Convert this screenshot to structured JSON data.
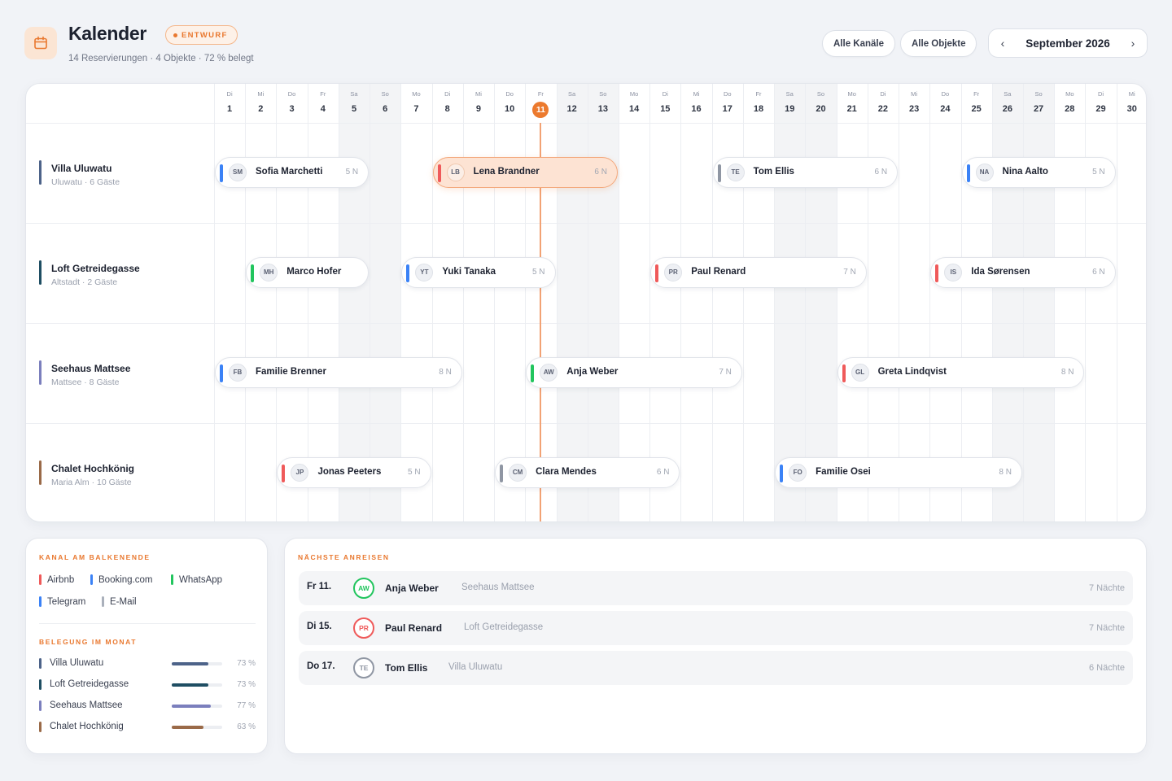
{
  "header": {
    "title": "Kalender",
    "badge": "ENTWURF",
    "subtitle": "14 Reservierungen · 4 Objekte · 72 % belegt",
    "filter_channels": "Alle Kanäle",
    "filter_objects": "Alle Objekte",
    "month": "September 2026",
    "prev_icon": "‹",
    "next_icon": "›"
  },
  "calendar": {
    "today": 11,
    "days": [
      {
        "wd": "Di",
        "d": 1
      },
      {
        "wd": "Mi",
        "d": 2
      },
      {
        "wd": "Do",
        "d": 3
      },
      {
        "wd": "Fr",
        "d": 4
      },
      {
        "wd": "Sa",
        "d": 5
      },
      {
        "wd": "So",
        "d": 6
      },
      {
        "wd": "Mo",
        "d": 7
      },
      {
        "wd": "Di",
        "d": 8
      },
      {
        "wd": "Mi",
        "d": 9
      },
      {
        "wd": "Do",
        "d": 10
      },
      {
        "wd": "Fr",
        "d": 11
      },
      {
        "wd": "Sa",
        "d": 12
      },
      {
        "wd": "So",
        "d": 13
      },
      {
        "wd": "Mo",
        "d": 14
      },
      {
        "wd": "Di",
        "d": 15
      },
      {
        "wd": "Mi",
        "d": 16
      },
      {
        "wd": "Do",
        "d": 17
      },
      {
        "wd": "Fr",
        "d": 18
      },
      {
        "wd": "Sa",
        "d": 19
      },
      {
        "wd": "So",
        "d": 20
      },
      {
        "wd": "Mo",
        "d": 21
      },
      {
        "wd": "Di",
        "d": 22
      },
      {
        "wd": "Mi",
        "d": 23
      },
      {
        "wd": "Do",
        "d": 24
      },
      {
        "wd": "Fr",
        "d": 25
      },
      {
        "wd": "Sa",
        "d": 26
      },
      {
        "wd": "So",
        "d": 27
      },
      {
        "wd": "Mo",
        "d": 28
      },
      {
        "wd": "Di",
        "d": 29
      },
      {
        "wd": "Mi",
        "d": 30
      }
    ],
    "properties": [
      {
        "name": "Villa Uluwatu",
        "sub": "Uluwatu · 6 Gäste",
        "color": "#4d6389",
        "reservations": [
          {
            "initials": "SM",
            "name": "Sofia Marchetti",
            "nights": "5 N",
            "start": 1,
            "end": 5,
            "channel": "#3b82f6"
          },
          {
            "initials": "LB",
            "name": "Lena Brandner",
            "nights": "6 N",
            "start": 8,
            "end": 13,
            "channel": "#ef5a5a",
            "selected": true
          },
          {
            "initials": "TE",
            "name": "Tom Ellis",
            "nights": "6 N",
            "start": 17,
            "end": 22,
            "channel": "#8f96a3"
          },
          {
            "initials": "NA",
            "name": "Nina Aalto",
            "nights": "5 N",
            "start": 25,
            "end": 29,
            "channel": "#3b82f6"
          }
        ]
      },
      {
        "name": "Loft Getreidegasse",
        "sub": "Altstadt · 2 Gäste",
        "color": "#1f4e63",
        "reservations": [
          {
            "initials": "MH",
            "name": "Marco Hofer",
            "nights": "",
            "start": 2,
            "end": 5,
            "channel": "#22c55e"
          },
          {
            "initials": "YT",
            "name": "Yuki Tanaka",
            "nights": "5 N",
            "start": 7,
            "end": 11,
            "channel": "#3b82f6"
          },
          {
            "initials": "PR",
            "name": "Paul Renard",
            "nights": "7 N",
            "start": 15,
            "end": 21,
            "channel": "#ef5a5a"
          },
          {
            "initials": "IS",
            "name": "Ida Sørensen",
            "nights": "6 N",
            "start": 24,
            "end": 29,
            "channel": "#ef5a5a"
          }
        ]
      },
      {
        "name": "Seehaus Mattsee",
        "sub": "Mattsee · 8 Gäste",
        "color": "#7b7fbd",
        "reservations": [
          {
            "initials": "FB",
            "name": "Familie Brenner",
            "nights": "8 N",
            "start": 1,
            "end": 8,
            "channel": "#3b82f6"
          },
          {
            "initials": "AW",
            "name": "Anja Weber",
            "nights": "7 N",
            "start": 11,
            "end": 17,
            "channel": "#22c55e"
          },
          {
            "initials": "GL",
            "name": "Greta Lindqvist",
            "nights": "8 N",
            "start": 21,
            "end": 28,
            "channel": "#ef5a5a"
          }
        ]
      },
      {
        "name": "Chalet Hochkönig",
        "sub": "Maria Alm · 10 Gäste",
        "color": "#9a6a48",
        "reservations": [
          {
            "initials": "JP",
            "name": "Jonas Peeters",
            "nights": "5 N",
            "start": 3,
            "end": 7,
            "channel": "#ef5a5a"
          },
          {
            "initials": "CM",
            "name": "Clara Mendes",
            "nights": "6 N",
            "start": 10,
            "end": 15,
            "channel": "#8f96a3"
          },
          {
            "initials": "FO",
            "name": "Familie Osei",
            "nights": "8 N",
            "start": 19,
            "end": 26,
            "channel": "#3b82f6"
          }
        ]
      }
    ]
  },
  "legend": {
    "title": "KANAL AM BALKENENDE",
    "channels": [
      {
        "label": "Airbnb",
        "color": "#ef5a5a"
      },
      {
        "label": "Booking.com",
        "color": "#3b82f6"
      },
      {
        "label": "WhatsApp",
        "color": "#22c55e"
      },
      {
        "label": "Telegram",
        "color": "#3b82f6"
      },
      {
        "label": "E-Mail",
        "color": "#aab0bb"
      }
    ],
    "occupancy_title": "BELEGUNG IM MONAT",
    "occupancy": [
      {
        "label": "Villa Uluwatu",
        "pct": "73 %",
        "value": 0.73,
        "color": "#4d6389"
      },
      {
        "label": "Loft Getreidegasse",
        "pct": "73 %",
        "value": 0.73,
        "color": "#1f4e63"
      },
      {
        "label": "Seehaus Mattsee",
        "pct": "77 %",
        "value": 0.77,
        "color": "#7b7fbd"
      },
      {
        "label": "Chalet Hochkönig",
        "pct": "63 %",
        "value": 0.63,
        "color": "#9a6a48"
      }
    ]
  },
  "arrivals": {
    "title": "NÄCHSTE ANREISEN",
    "items": [
      {
        "date": "Fr 11.",
        "initials": "AW",
        "name": "Anja Weber",
        "property": "Seehaus Mattsee",
        "nights": "7 Nächte",
        "color": "#22c55e"
      },
      {
        "date": "Di 15.",
        "initials": "PR",
        "name": "Paul Renard",
        "property": "Loft Getreidegasse",
        "nights": "7 Nächte",
        "color": "#ef5a5a"
      },
      {
        "date": "Do 17.",
        "initials": "TE",
        "name": "Tom Ellis",
        "property": "Villa Uluwatu",
        "nights": "6 Nächte",
        "color": "#8f96a3"
      }
    ]
  }
}
